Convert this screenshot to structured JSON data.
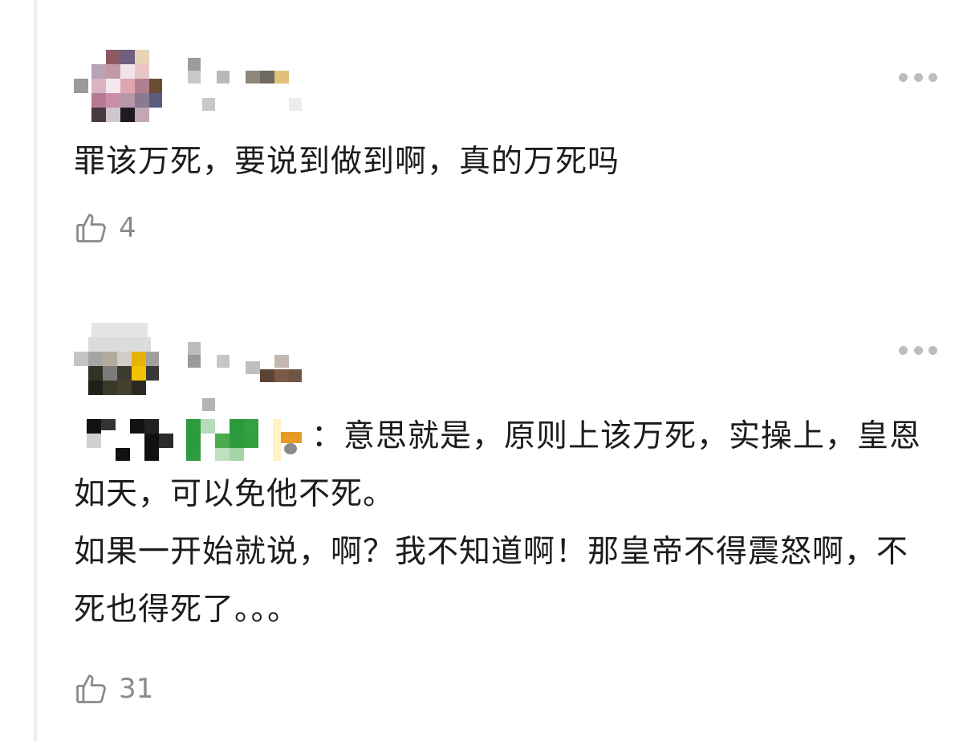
{
  "comments": [
    {
      "avatar": "pixelated-avatar",
      "username": "",
      "text": "罪该万死，要说到做到啊，真的万死吗",
      "likes": "4"
    },
    {
      "avatar": "pixelated-avatar",
      "username": "",
      "reply_to": "",
      "reply_text": "：意思就是，原则上该万死，实操上，皇恩如天，可以免他不死。\n如果一开始就说，啊？我不知道啊！那皇帝不得震怒啊，不死也得死了。。。",
      "likes": "31"
    }
  ],
  "icons": {
    "like": "thumbs-up-icon",
    "more": "more-dots-icon"
  },
  "colors": {
    "text": "#1c1c1c",
    "muted": "#8a8a8a",
    "dots": "#bdbdbd"
  }
}
